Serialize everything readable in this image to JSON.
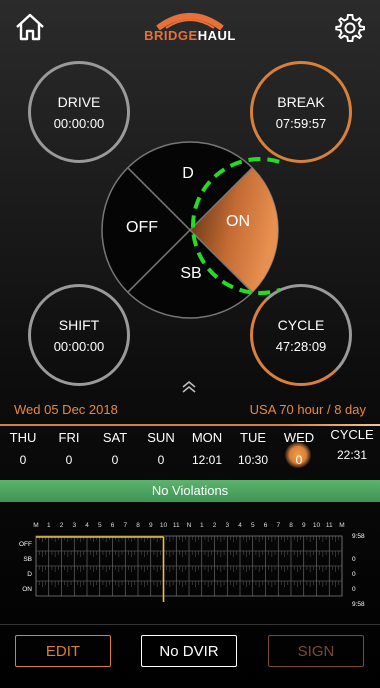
{
  "header": {
    "logo_bridge": "BRIDGE",
    "logo_haul": "HAUL"
  },
  "clocks": {
    "drive": {
      "label": "DRIVE",
      "value": "00:00:00"
    },
    "break": {
      "label": "BREAK",
      "value": "07:59:57"
    },
    "shift": {
      "label": "SHIFT",
      "value": "00:00:00"
    },
    "cycle": {
      "label": "CYCLE",
      "value": "47:28:09"
    }
  },
  "dial": {
    "d": "D",
    "off": "OFF",
    "on": "ON",
    "sb": "SB",
    "active": "ON"
  },
  "date_bar": {
    "date": "Wed 05 Dec 2018",
    "rule": "USA 70 hour / 8 day"
  },
  "days": [
    {
      "name": "THU",
      "hours": "0"
    },
    {
      "name": "FRI",
      "hours": "0"
    },
    {
      "name": "SAT",
      "hours": "0"
    },
    {
      "name": "SUN",
      "hours": "0"
    },
    {
      "name": "MON",
      "hours": "12:01"
    },
    {
      "name": "TUE",
      "hours": "10:30"
    },
    {
      "name": "WED",
      "hours": "0"
    }
  ],
  "cycle_total": {
    "label": "CYCLE",
    "value": "22:31"
  },
  "violations": "No Violations",
  "log_graph": {
    "hour_labels": [
      "M",
      "1",
      "2",
      "3",
      "4",
      "5",
      "6",
      "7",
      "8",
      "9",
      "10",
      "11",
      "N",
      "1",
      "2",
      "3",
      "4",
      "5",
      "6",
      "7",
      "8",
      "9",
      "10",
      "11",
      "M"
    ],
    "rows": [
      "OFF",
      "SB",
      "D",
      "ON"
    ],
    "totals": [
      "9:58",
      "0",
      "0",
      "0"
    ],
    "grand_total": "9:58",
    "colors": {
      "line": "#e8c23a",
      "grid": "#777777"
    }
  },
  "buttons": {
    "edit": "EDIT",
    "dvir": "No DVIR",
    "sign": "SIGN"
  },
  "colors": {
    "accent": "#d9803b",
    "highlight_ring": "#22dd22",
    "violation_bg": "#4fa862"
  }
}
